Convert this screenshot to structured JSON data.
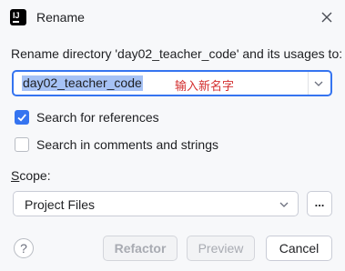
{
  "window": {
    "title": "Rename",
    "app_icon_text": "IJ"
  },
  "prompt": "Rename directory 'day02_teacher_code' and its usages to:",
  "name_field": {
    "value": "day02_teacher_code",
    "annotation": "输入新名字"
  },
  "options": {
    "search_references": {
      "label": "Search for references",
      "checked": true
    },
    "search_comments": {
      "label": "Search in comments and strings",
      "checked": false
    }
  },
  "scope": {
    "label_mnemonic": "S",
    "label_rest": "cope:",
    "value": "Project Files",
    "more_label": "..."
  },
  "buttons": {
    "help": "?",
    "refactor": "Refactor",
    "preview": "Preview",
    "cancel": "Cancel"
  },
  "colors": {
    "accent": "#3574f0",
    "selection": "#a6c2f5",
    "annotation": "#d32f2f",
    "background": "#f7f8fa"
  }
}
